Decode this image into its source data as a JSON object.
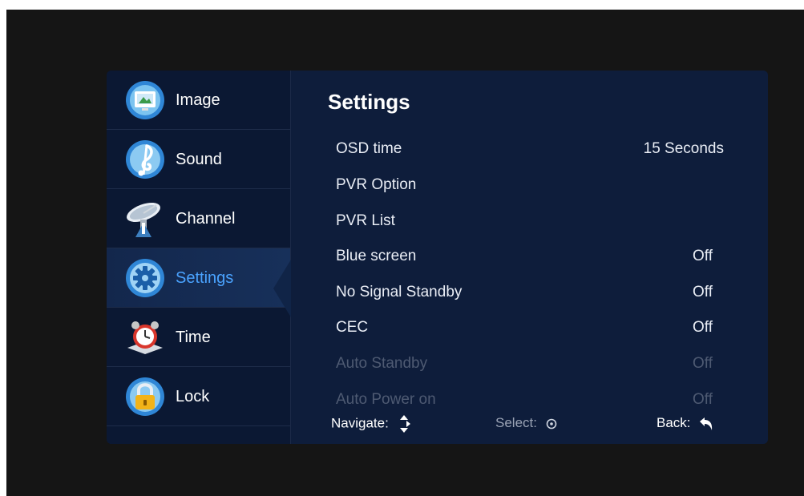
{
  "menu": {
    "items": [
      {
        "label": "Image",
        "icon": "image-icon",
        "active": false
      },
      {
        "label": "Sound",
        "icon": "music-note-icon",
        "active": false
      },
      {
        "label": "Channel",
        "icon": "satellite-dish-icon",
        "active": false
      },
      {
        "label": "Settings",
        "icon": "gear-icon",
        "active": true
      },
      {
        "label": "Time",
        "icon": "alarm-clock-icon",
        "active": false
      },
      {
        "label": "Lock",
        "icon": "padlock-icon",
        "active": false
      }
    ]
  },
  "main": {
    "title": "Settings",
    "rows": [
      {
        "label": "OSD time",
        "value": "15 Seconds",
        "enabled": true
      },
      {
        "label": "PVR Option",
        "value": "",
        "enabled": true
      },
      {
        "label": "PVR List",
        "value": "",
        "enabled": true
      },
      {
        "label": "Blue screen",
        "value": "Off",
        "enabled": true
      },
      {
        "label": "No Signal Standby",
        "value": "Off",
        "enabled": true
      },
      {
        "label": "CEC",
        "value": "Off",
        "enabled": true
      },
      {
        "label": "Auto Standby",
        "value": "Off",
        "enabled": false
      },
      {
        "label": "Auto Power on",
        "value": "Off",
        "enabled": false
      }
    ]
  },
  "footer": {
    "navigate_label": "Navigate:",
    "select_label": "Select:",
    "back_label": "Back:"
  },
  "colors": {
    "accent": "#4aa3ff",
    "panel_bg": "#0e1d3b",
    "disabled_text": "#4e5a72"
  }
}
